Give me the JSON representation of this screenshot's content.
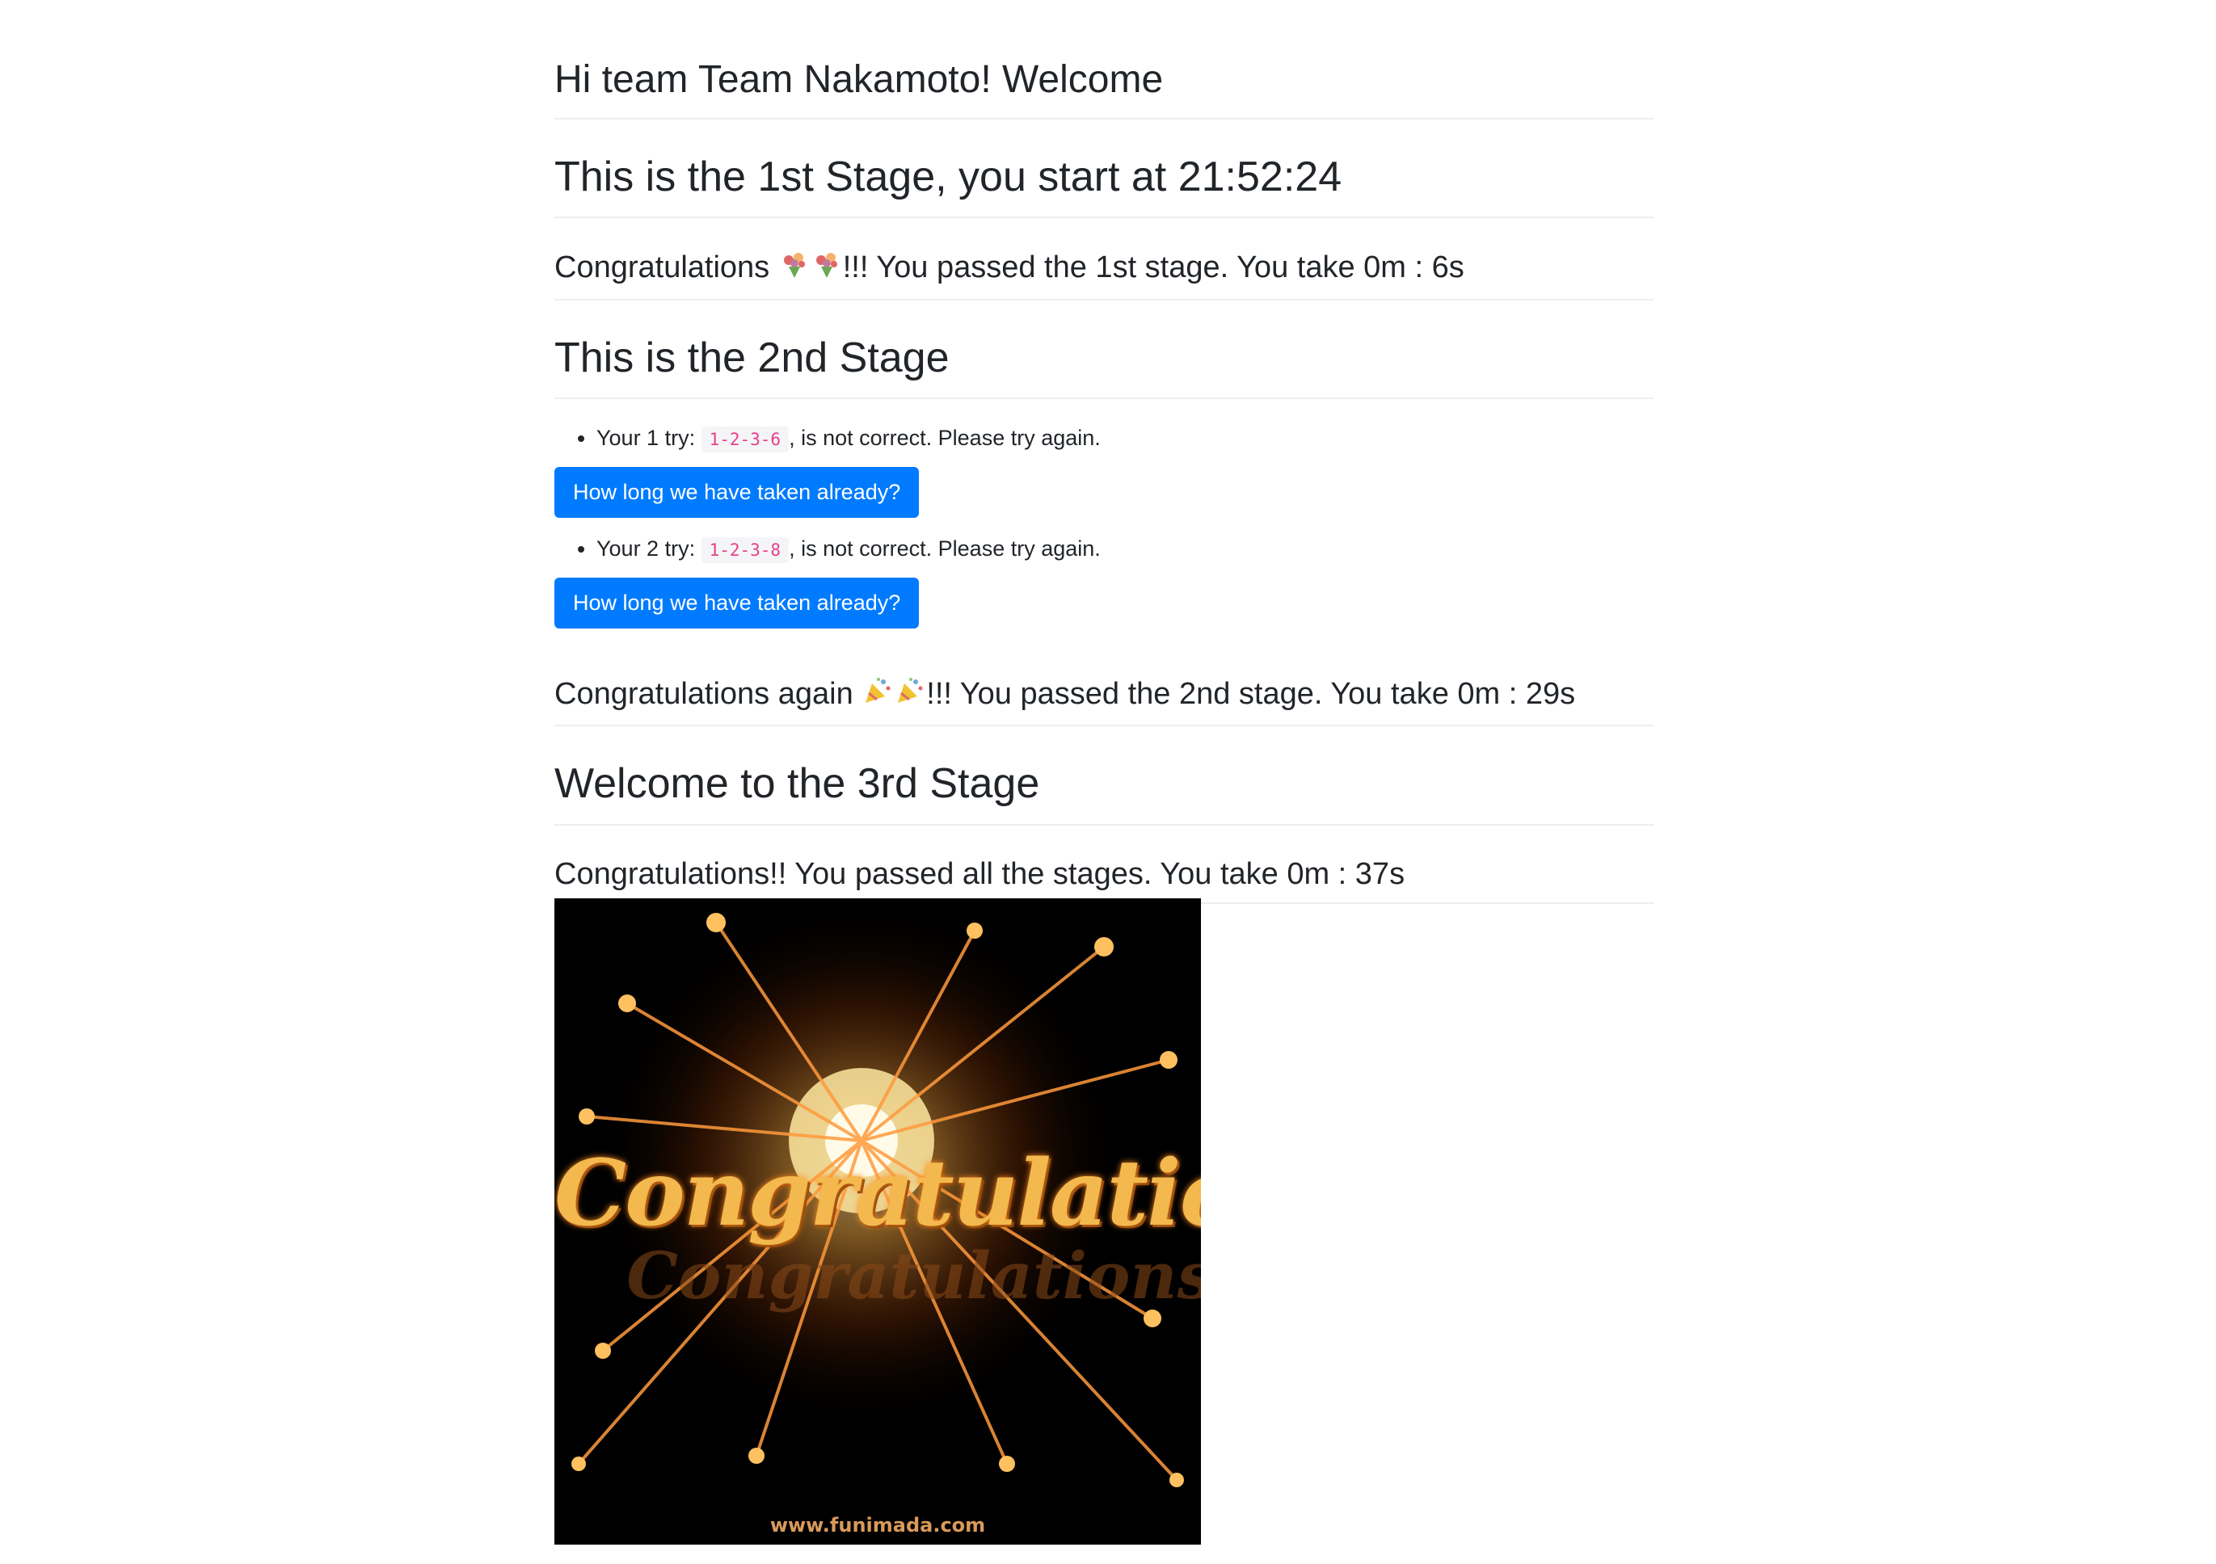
{
  "greeting": "Hi team Team Nakamoto! Welcome",
  "stage1": {
    "title": "This is the 1st Stage, you start at 21:52:24",
    "congrats_prefix": "Congratulations ",
    "congrats_suffix": "!!! You passed the 1st stage. You take 0m : 6s"
  },
  "stage2": {
    "title": "This is the 2nd Stage",
    "tries": [
      {
        "prefix": "Your 1 try: ",
        "code": "1-2-3-6",
        "suffix": ", is not correct. Please try again."
      },
      {
        "prefix": "Your 2 try: ",
        "code": "1-2-3-8",
        "suffix": ", is not correct. Please try again."
      }
    ],
    "button_label": "How long we have taken already?",
    "congrats_prefix": "Congratulations again ",
    "congrats_suffix": "!!! You passed the 2nd stage. You take 0m : 29s"
  },
  "stage3": {
    "title": "Welcome to the 3rd Stage",
    "final_message": "Congratulations!! You passed all the stages. You take 0m : 37s"
  },
  "image": {
    "caption_text": "Congratulations!",
    "watermark": "www.funimada.com"
  },
  "colors": {
    "button_bg": "#007bff",
    "code_text": "#e83e8c"
  },
  "icons": [
    "bouquet-icon",
    "party-popper-icon"
  ]
}
